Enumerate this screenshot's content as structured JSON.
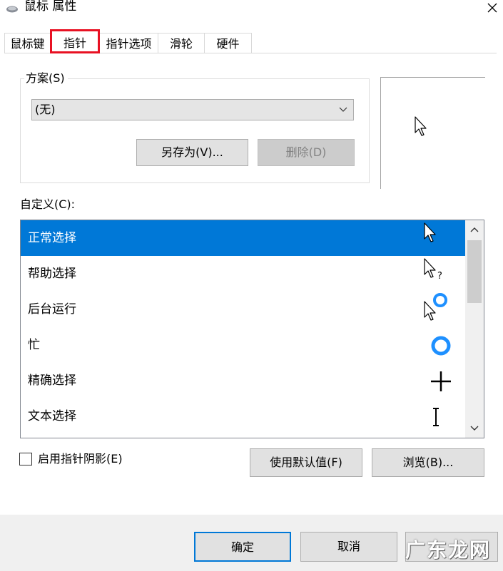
{
  "window": {
    "title": "鼠标 属性",
    "close_icon": "close-icon"
  },
  "tabs": [
    {
      "label": "鼠标键",
      "selected": false
    },
    {
      "label": "指针",
      "selected": true
    },
    {
      "label": "指针选项",
      "selected": false
    },
    {
      "label": "滑轮",
      "selected": false
    },
    {
      "label": "硬件",
      "selected": false
    }
  ],
  "scheme": {
    "label": "方案(S)",
    "selected_value": "(无)",
    "save_as_label": "另存为(V)...",
    "delete_label": "删除(D)"
  },
  "customize": {
    "label": "自定义(C):",
    "items": [
      {
        "label": "正常选择",
        "icon": "arrow-cursor-icon",
        "selected": true
      },
      {
        "label": "帮助选择",
        "icon": "help-cursor-icon",
        "selected": false
      },
      {
        "label": "后台运行",
        "icon": "working-in-background-cursor-icon",
        "selected": false
      },
      {
        "label": "忙",
        "icon": "busy-cursor-icon",
        "selected": false
      },
      {
        "label": "精确选择",
        "icon": "precision-cross-cursor-icon",
        "selected": false
      },
      {
        "label": "文本选择",
        "icon": "text-beam-cursor-icon",
        "selected": false
      }
    ]
  },
  "options": {
    "shadow_label": "启用指针阴影(E)",
    "shadow_checked": false,
    "default_label": "使用默认值(F)",
    "browse_label": "浏览(B)..."
  },
  "footer": {
    "ok_label": "确定",
    "cancel_label": "取消",
    "watermark": "广东龙网"
  },
  "colors": {
    "selection": "#0078d7",
    "highlight_border": "#e81123",
    "busy_ring": "#1e90ff"
  }
}
